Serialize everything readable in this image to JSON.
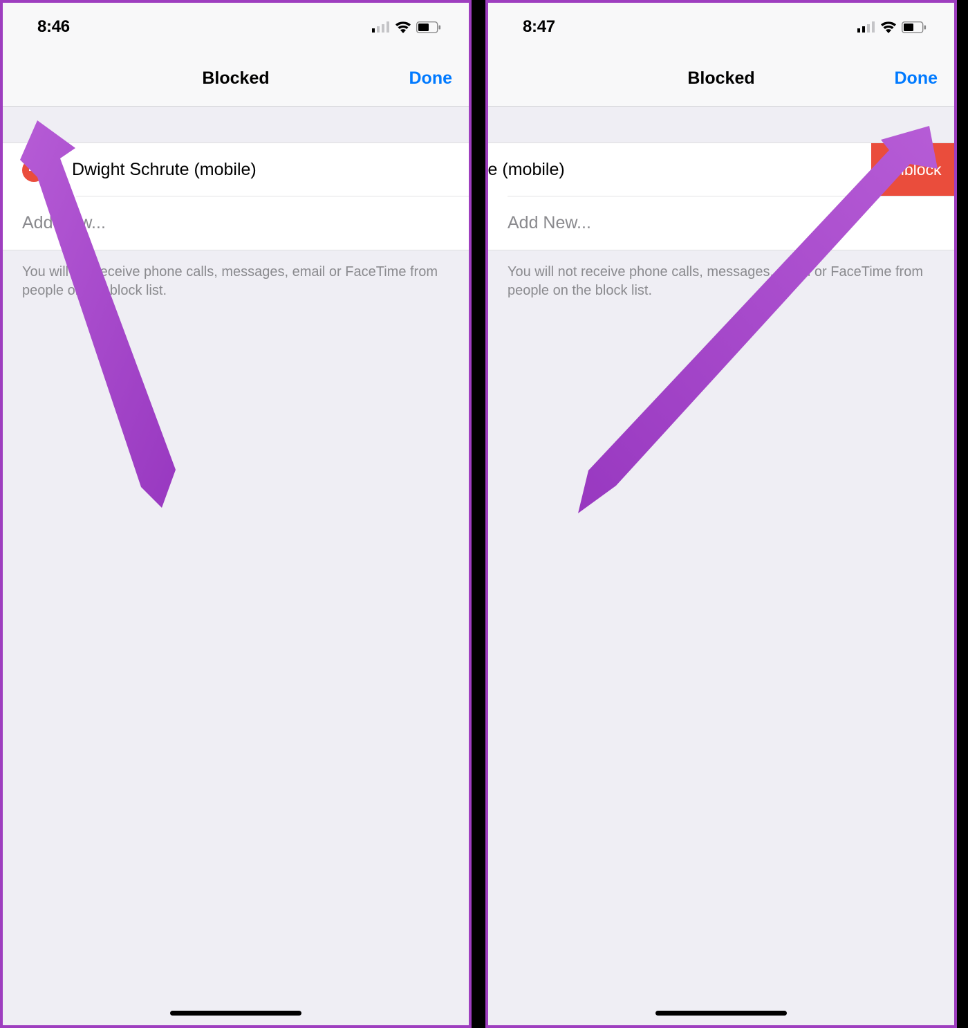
{
  "left": {
    "time": "8:46",
    "title": "Blocked",
    "done": "Done",
    "contact": "Dwight Schrute (mobile)",
    "add_new": "Add New...",
    "footer": "You will not receive phone calls, messages, email or FaceTime from people on the block list."
  },
  "right": {
    "time": "8:47",
    "title": "Blocked",
    "done": "Done",
    "contact": "wight Schrute (mobile)",
    "unblock": "Unblock",
    "add_new": "Add New...",
    "footer": "You will not receive phone calls, messages, email or FaceTime from people on the block list."
  }
}
